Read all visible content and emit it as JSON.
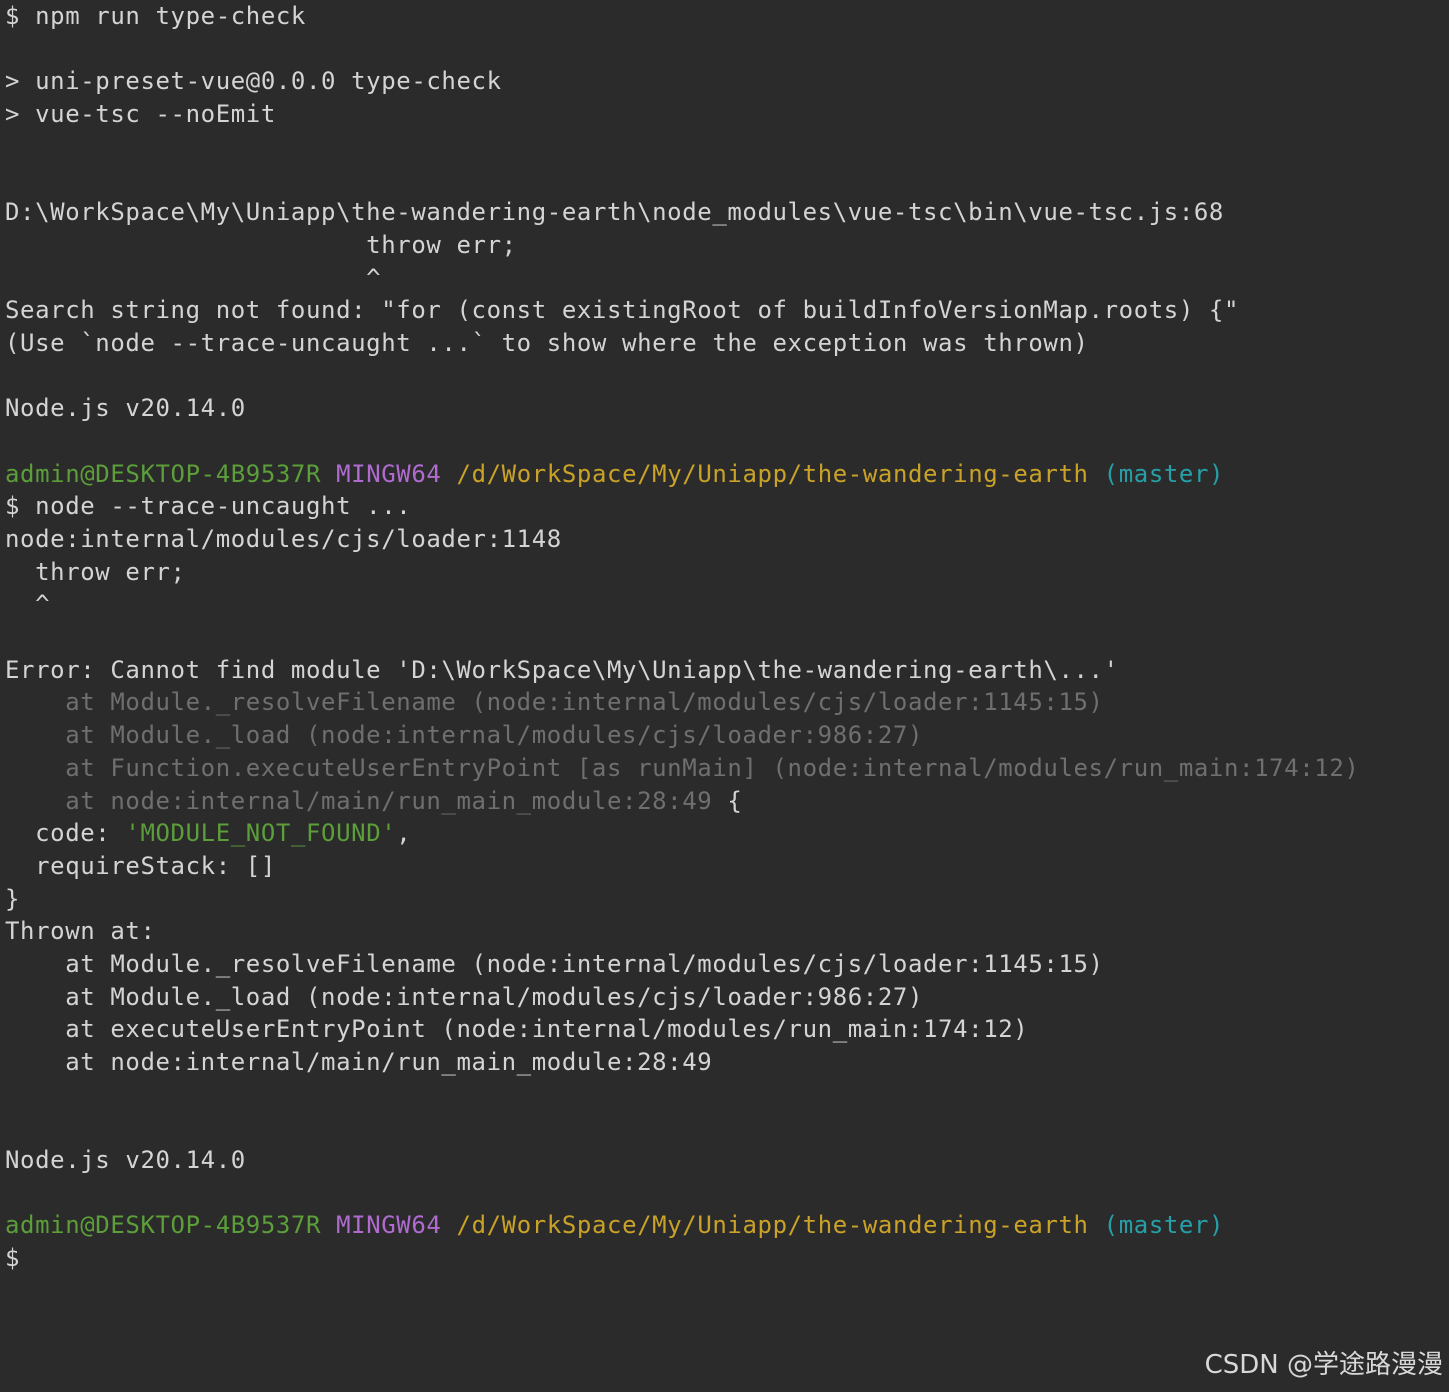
{
  "terminal": {
    "lines": [
      "$ npm run type-check",
      "",
      "> uni-preset-vue@0.0.0 type-check",
      "> vue-tsc --noEmit",
      "",
      "",
      "D:\\WorkSpace\\My\\Uniapp\\the-wandering-earth\\node_modules\\vue-tsc\\bin\\vue-tsc.js:68",
      "                        throw err;",
      "                        ^",
      "Search string not found: \"for (const existingRoot of buildInfoVersionMap.roots) {\"",
      "(Use `node --trace-uncaught ...` to show where the exception was thrown)",
      "",
      "Node.js v20.14.0",
      "",
      "",
      "$ node --trace-uncaught ...",
      "node:internal/modules/cjs/loader:1148",
      "  throw err;",
      "  ^",
      "",
      "Error: Cannot find module 'D:\\WorkSpace\\My\\Uniapp\\the-wandering-earth\\...'",
      "",
      "",
      "",
      "",
      "",
      "  requireStack: []",
      "}",
      "Thrown at:",
      "    at Module._resolveFilename (node:internal/modules/cjs/loader:1145:15)",
      "    at Module._load (node:internal/modules/cjs/loader:986:27)",
      "    at executeUserEntryPoint (node:internal/modules/run_main:174:12)",
      "    at node:internal/main/run_main_module:28:49",
      "",
      "",
      "Node.js v20.14.0",
      "",
      "",
      "$"
    ],
    "prompt_1": {
      "user": "admin@DESKTOP-4B9537R",
      "shell": "MINGW64",
      "path": "/d/WorkSpace/My/Uniapp/the-wandering-earth",
      "branch": "(master)"
    },
    "prompt_2": {
      "user": "admin@DESKTOP-4B9537R",
      "shell": "MINGW64",
      "path": "/d/WorkSpace/My/Uniapp/the-wandering-earth",
      "branch": "(master)"
    },
    "stack_dim": [
      "    at Module._resolveFilename (node:internal/modules/cjs/loader:1145:15)",
      "    at Module._load (node:internal/modules/cjs/loader:986:27)",
      "    at Function.executeUserEntryPoint [as runMain] (node:internal/modules/run_main:174:12)",
      "    at node:internal/main/run_main_module:28:49"
    ],
    "stack_dim_tail": " {",
    "code_line": {
      "prefix": "  code: ",
      "value": "'MODULE_NOT_FOUND'",
      "suffix": ","
    }
  },
  "watermark": "CSDN @学途路漫漫",
  "colors": {
    "background": "#2b2b2b",
    "text": "#d4d4d4",
    "user": "#5c9e3a",
    "shell": "#b06bd1",
    "path": "#c9a227",
    "branch": "#26a0a8",
    "dim": "#6f6f6f"
  }
}
